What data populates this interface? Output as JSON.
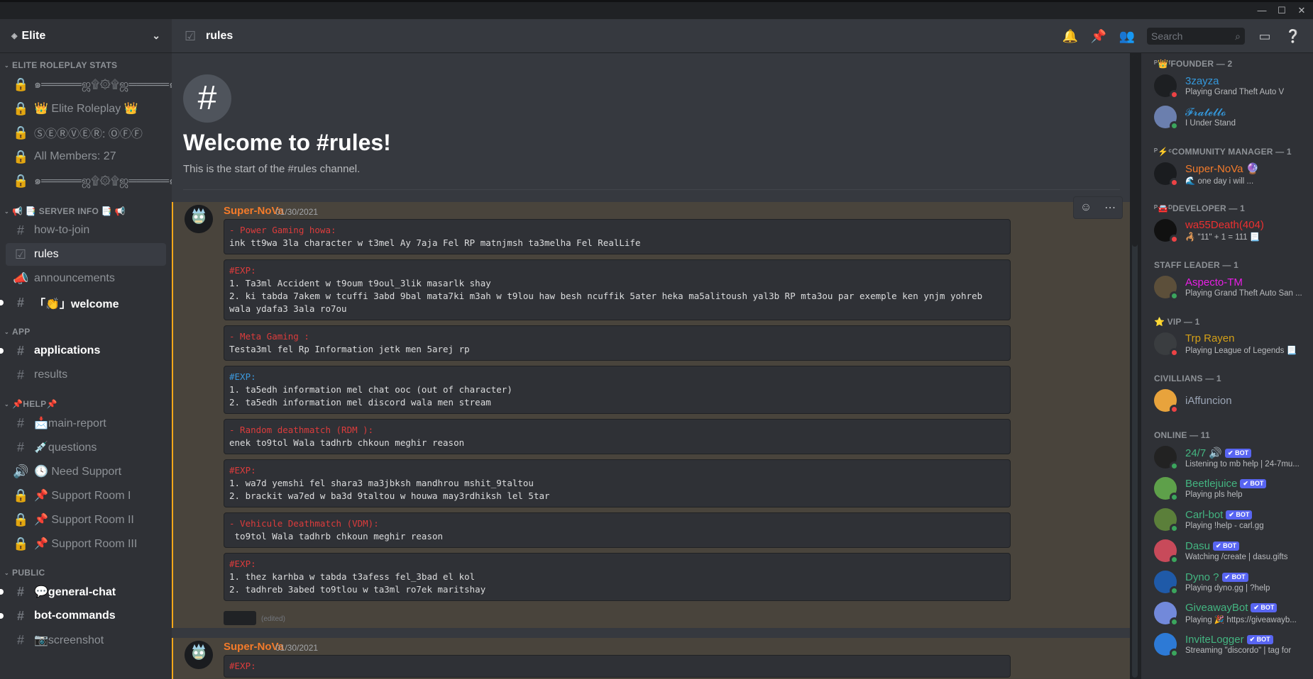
{
  "window": {
    "minimize": "—",
    "maximize": "☐",
    "close": "✕"
  },
  "server": {
    "name": "Elite"
  },
  "sidebar": {
    "categories": [
      {
        "label": "ELITE ROLEPLAY STATS"
      },
      {
        "label": "📢 📑 SERVER INFO 📑 📢"
      },
      {
        "label": "APP"
      },
      {
        "label": "📌HELP📌"
      },
      {
        "label": "PUBLIC"
      }
    ],
    "channels": [
      {
        "label": "๑═════ஜ۩۞۩ஜ═════๑"
      },
      {
        "label": "👑 Elite Roleplay 👑"
      },
      {
        "label": "ⓈⒺⓇⓋⒺⓇ: ⓄⒻⒻ"
      },
      {
        "label": "All Members: 27"
      },
      {
        "label": "๑═════ஜ۩۞۩ஜ═════๑"
      },
      {
        "label": "how-to-join"
      },
      {
        "label": "rules"
      },
      {
        "label": "announcements"
      },
      {
        "label": "「👏」welcome"
      },
      {
        "label": "applications"
      },
      {
        "label": "results"
      },
      {
        "label": "📩main-report"
      },
      {
        "label": "💉questions"
      },
      {
        "label": "🕓 Need Support"
      },
      {
        "label": "📌 Support Room I"
      },
      {
        "label": "📌 Support Room II"
      },
      {
        "label": "📌 Support Room III"
      },
      {
        "label": "💬general-chat"
      },
      {
        "label": "bot-commands"
      },
      {
        "label": "📷screenshot"
      }
    ]
  },
  "header": {
    "channel": "rules",
    "search_placeholder": "Search"
  },
  "welcome": {
    "icon": "#",
    "title": "Welcome to #rules!",
    "subtitle": "This is the start of the #rules channel."
  },
  "messages": [
    {
      "author": "Super-NoVa",
      "timestamp": "01/30/2021",
      "blocks": [
        {
          "lines": [
            {
              "t": "- Power Gaming howa:",
              "c": "red"
            },
            {
              "t": "ink tt9wa 3la character w t3mel Ay 7aja Fel RP matnjmsh ta3melha Fel RealLife",
              "c": ""
            }
          ]
        },
        {
          "lines": [
            {
              "t": "#EXP:",
              "c": "red"
            },
            {
              "t": "1. Ta3ml Accident w t9oum t9oul_3lik masarlk shay",
              "c": ""
            },
            {
              "t": "2. ki tabda 7akem w tcuffi 3abd 9bal mata7ki m3ah w t9lou haw besh ncuffik 5ater heka ma5alitoush yal3b RP mta3ou par exemple ken ynjm yohreb",
              "c": ""
            },
            {
              "t": "wala ydafa3 3ala ro7ou",
              "c": ""
            }
          ]
        },
        {
          "lines": [
            {
              "t": "- Meta Gaming :",
              "c": "red"
            },
            {
              "t": "Testa3ml fel Rp Information jetk men 5arej rp",
              "c": ""
            }
          ]
        },
        {
          "lines": [
            {
              "t": "#EXP:",
              "c": "blue"
            },
            {
              "t": "1. ta5edh information mel chat ooc (out of character)",
              "c": ""
            },
            {
              "t": "2. ta5edh information mel discord wala men stream",
              "c": ""
            }
          ]
        },
        {
          "lines": [
            {
              "t": "- Random deathmatch (RDM ):",
              "c": "red"
            },
            {
              "t": "enek to9tol Wala tadhrb chkoun meghir reason",
              "c": ""
            }
          ]
        },
        {
          "lines": [
            {
              "t": "#EXP:",
              "c": "red"
            },
            {
              "t": "1. wa7d yemshi fel shara3 ma3jbksh mandhrou mshit_9taltou",
              "c": ""
            },
            {
              "t": "2. brackit wa7ed w ba3d 9taltou w houwa may3rdhiksh lel 5tar",
              "c": ""
            }
          ]
        },
        {
          "lines": [
            {
              "t": "- Vehicule Deathmatch (VDM):",
              "c": "red"
            },
            {
              "t": " to9tol Wala tadhrb chkoun meghir reason",
              "c": ""
            }
          ]
        },
        {
          "lines": [
            {
              "t": "#EXP:",
              "c": "red"
            },
            {
              "t": "1. thez karhba w tabda t3afess fel_3bad el kol",
              "c": ""
            },
            {
              "t": "2. tadhreb 3abed to9tlou w ta3ml ro7ek maritshay",
              "c": ""
            }
          ]
        }
      ],
      "edited": "(edited)"
    },
    {
      "author": "Super-NoVa",
      "timestamp": "01/30/2021",
      "blocks": [
        {
          "lines": [
            {
              "t": "#EXP:",
              "c": "red"
            }
          ]
        }
      ]
    }
  ],
  "members": {
    "groups": [
      {
        "label": "ᴾ👑ᶠFOUNDER — 2",
        "members": [
          {
            "name": "3zayza",
            "color": "#3498db",
            "activity": "Playing Grand Theft Auto V",
            "status": "dnd",
            "av": "#1d1f22"
          },
          {
            "name": "𝓕𝓻𝓪𝓽𝓮𝓵𝓵𝓸",
            "color": "#3498db",
            "activity": "I Under Stand",
            "status": "on",
            "av": "#6b7fae"
          }
        ]
      },
      {
        "label": "ᴾ⚡ᶜCOMMUNITY MANAGER — 1",
        "members": [
          {
            "name": "Super-NoVa 🔮",
            "color": "#f47b2a",
            "activity": "🌊 one day i will ...",
            "status": "dnd",
            "av": "#1a1c1f"
          }
        ]
      },
      {
        "label": "ᴾ🚘ᴰDEVELOPER — 1",
        "members": [
          {
            "name": "wa55Death(404)",
            "color": "#ed3030",
            "activity": "🦂 \"11\" + 1 = 111 📃",
            "status": "dnd",
            "av": "#111"
          }
        ]
      },
      {
        "label": "STAFF LEADER — 1",
        "members": [
          {
            "name": "Aspecto-TM",
            "color": "#e91ee6",
            "activity": "Playing Grand Theft Auto San ...",
            "status": "on",
            "av": "#5c4f3a"
          }
        ]
      },
      {
        "label": "⭐ VIP — 1",
        "members": [
          {
            "name": "Trp Rayen",
            "color": "#d4a017",
            "activity": "Playing League of Legends 📃",
            "status": "dnd",
            "av": "#3a3d40"
          }
        ]
      },
      {
        "label": "CIVILLIANS — 1",
        "members": [
          {
            "name": "iAffuncion",
            "color": "#9aa4b4",
            "activity": "",
            "status": "dnd",
            "av": "#e8a33c"
          }
        ]
      },
      {
        "label": "ONLINE — 11",
        "members": [
          {
            "name": "24/7 🔊",
            "color": "#43b581",
            "activity": "Listening to mb help | 24-7mu...",
            "status": "on",
            "av": "#222",
            "bot": "✔ BOT"
          },
          {
            "name": "Beetlejuice",
            "color": "#43b581",
            "activity": "Playing pls help",
            "status": "on",
            "av": "#5ea04a",
            "bot": "✔ BOT"
          },
          {
            "name": "Carl-bot",
            "color": "#43b581",
            "activity": "Playing !help - carl.gg",
            "status": "on",
            "av": "#5b7f3a",
            "bot": "✔ BOT"
          },
          {
            "name": "Dasu",
            "color": "#43b581",
            "activity": "Watching /create | dasu.gifts",
            "status": "on",
            "av": "#c84a5a",
            "bot": "✔ BOT"
          },
          {
            "name": "Dyno ?",
            "color": "#43b581",
            "activity": "Playing dyno.gg | ?help",
            "status": "on",
            "av": "#1f5aa8",
            "bot": "✔ BOT"
          },
          {
            "name": "GiveawayBot",
            "color": "#43b581",
            "activity": "Playing 🎉 https://giveawayb...",
            "status": "on",
            "av": "#7289da",
            "bot": "✔ BOT"
          },
          {
            "name": "InviteLogger",
            "color": "#43b581",
            "activity": "Streaming \"discordo\" | tag for",
            "status": "on",
            "av": "#2d7ad6",
            "bot": "✔ BOT"
          }
        ]
      }
    ]
  }
}
